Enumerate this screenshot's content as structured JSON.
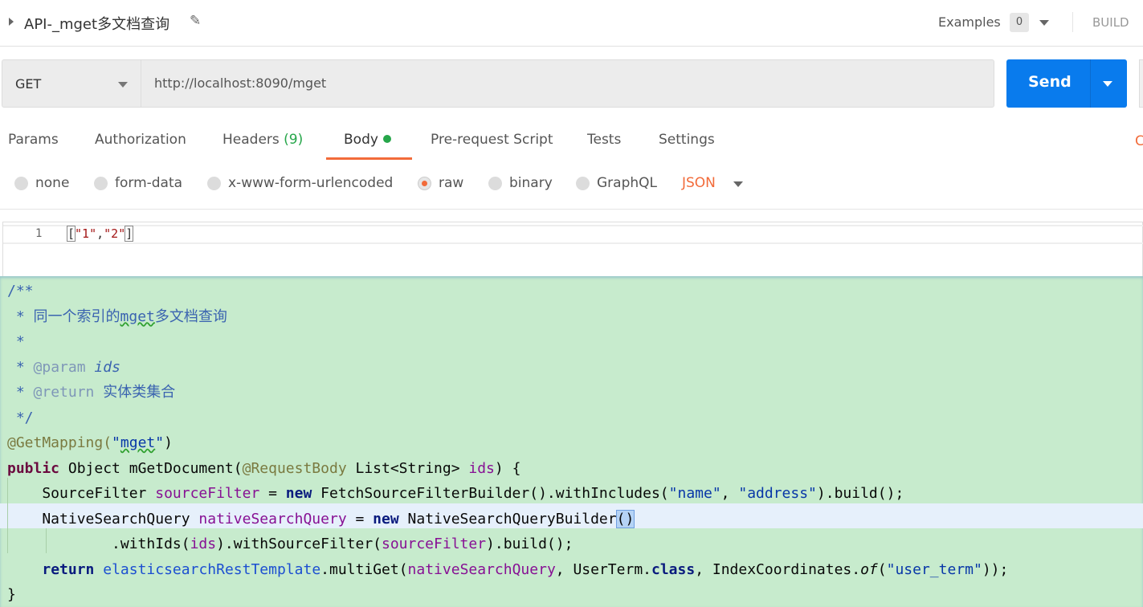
{
  "header": {
    "title": "API-_mget多文档查询",
    "examples_label": "Examples",
    "examples_count": "0",
    "build_label": "BUILD"
  },
  "request": {
    "method": "GET",
    "url": "http://localhost:8090/mget",
    "send_label": "Send"
  },
  "tabs": [
    {
      "label": "Params"
    },
    {
      "label": "Authorization"
    },
    {
      "label": "Headers",
      "count": "(9)"
    },
    {
      "label": "Body",
      "active": true
    },
    {
      "label": "Pre-request Script"
    },
    {
      "label": "Tests"
    },
    {
      "label": "Settings"
    }
  ],
  "cookies_label": "C",
  "body_types": [
    {
      "label": "none"
    },
    {
      "label": "form-data"
    },
    {
      "label": "x-www-form-urlencoded"
    },
    {
      "label": "raw",
      "selected": true
    },
    {
      "label": "binary"
    },
    {
      "label": "GraphQL"
    }
  ],
  "format": "JSON",
  "editor": {
    "line_number": "1",
    "open": "[",
    "s1": "\"1\"",
    "comma": ",",
    "s2": "\"2\"",
    "close": "]"
  },
  "colors": {
    "accent": "#f26b3a",
    "send": "#097bed",
    "ide_bg": "#c7ebcd"
  },
  "code_lines": [
    [
      [
        "/**",
        "cm"
      ]
    ],
    [
      [
        " * 同一个索引的",
        "cm"
      ],
      [
        "mget",
        "cm und"
      ],
      [
        "多文档查询",
        "cm"
      ]
    ],
    [
      [
        " *",
        "cm"
      ]
    ],
    [
      [
        " * ",
        "cm"
      ],
      [
        "@param",
        "tag"
      ],
      [
        " ",
        ""
      ],
      [
        "ids",
        "cmi"
      ]
    ],
    [
      [
        " * ",
        "cm"
      ],
      [
        "@return",
        "tag"
      ],
      [
        " 实体类集合",
        "cm"
      ]
    ],
    [
      [
        " */",
        "cm"
      ]
    ],
    [
      [
        "@GetMapping(",
        "an"
      ],
      [
        "\"",
        "str"
      ],
      [
        "mget",
        "str und"
      ],
      [
        "\"",
        "str"
      ],
      [
        ")",
        ""
      ]
    ],
    [
      [
        "public",
        "kw2"
      ],
      [
        " Object mGetDocument(",
        ""
      ],
      [
        "@RequestBody",
        "an"
      ],
      [
        " List<String> ",
        ""
      ],
      [
        "ids",
        "var"
      ],
      [
        ") {",
        ""
      ]
    ],
    [
      [
        "    SourceFilter ",
        ""
      ],
      [
        "sourceFilter",
        "var"
      ],
      [
        " = ",
        ""
      ],
      [
        "new",
        "kw"
      ],
      [
        " FetchSourceFilterBuilder().withIncludes(",
        ""
      ],
      [
        "\"name\"",
        "str"
      ],
      [
        ", ",
        ""
      ],
      [
        "\"address\"",
        "str"
      ],
      [
        ").build();",
        ""
      ]
    ],
    [
      [
        "    NativeSearchQuery ",
        ""
      ],
      [
        "nativeSearchQuery",
        "var"
      ],
      [
        " = ",
        ""
      ],
      [
        "new",
        "kw"
      ],
      [
        " NativeSearchQueryBuilder",
        ""
      ],
      [
        "()",
        "mbr"
      ]
    ],
    [
      [
        "            .withIds(",
        ""
      ],
      [
        "ids",
        "var"
      ],
      [
        ").withSourceFilter(",
        ""
      ],
      [
        "sourceFilter",
        "var"
      ],
      [
        ").build();",
        ""
      ]
    ],
    [
      [
        "    ",
        ""
      ],
      [
        "return",
        "kw"
      ],
      [
        " ",
        ""
      ],
      [
        "elasticsearchRestTemplate",
        "fld"
      ],
      [
        ".multiGet(",
        ""
      ],
      [
        "nativeSearchQuery",
        "var"
      ],
      [
        ", UserTerm.",
        ""
      ],
      [
        "class",
        "kw"
      ],
      [
        ", IndexCoordinates.",
        ""
      ],
      [
        "of",
        "it"
      ],
      [
        "(",
        ""
      ],
      [
        "\"user_term\"",
        "str"
      ],
      [
        "));",
        ""
      ]
    ],
    [
      [
        "}",
        ""
      ]
    ]
  ]
}
